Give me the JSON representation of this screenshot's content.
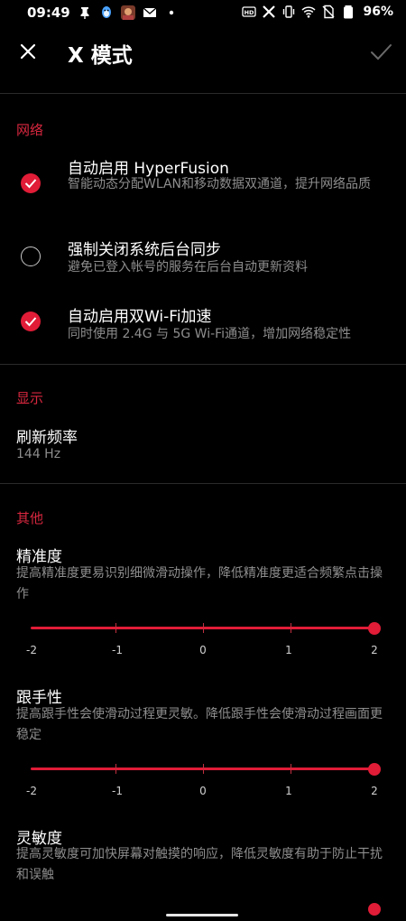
{
  "status_bar": {
    "time": "09:49",
    "battery": "96%",
    "left_icons": [
      "notification-pin-icon",
      "qq-penguin-icon",
      "game-avatar-icon",
      "mail-icon",
      "dot-icon"
    ],
    "right_icons": [
      "hd-icon",
      "x-app-icon",
      "vibrate-icon",
      "wifi-icon",
      "no-sim-icon",
      "battery-icon"
    ]
  },
  "header": {
    "title": "X 模式"
  },
  "network": {
    "section_title": "网络",
    "options": [
      {
        "title": "自动启用 HyperFusion",
        "desc": "智能动态分配WLAN和移动数据双通道，提升网络品质",
        "checked": true
      },
      {
        "title": "强制关闭系统后台同步",
        "desc": "避免已登入帐号的服务在后台自动更新资料",
        "checked": false
      },
      {
        "title": "自动启用双Wi-Fi加速",
        "desc": "同时使用 2.4G 与 5G Wi-Fi通道，增加网络稳定性",
        "checked": true
      }
    ]
  },
  "display": {
    "section_title": "显示",
    "refresh_rate_title": "刷新频率",
    "refresh_rate_value": "144 Hz"
  },
  "other": {
    "section_title": "其他",
    "precision": {
      "title": "精准度",
      "desc": "提高精准度更易识别细微滑动操作，降低精准度更适合频繁点击操作",
      "value": 2,
      "min": -2,
      "max": 2,
      "labels": [
        "-2",
        "-1",
        "0",
        "1",
        "2"
      ]
    },
    "tracking": {
      "title": "跟手性",
      "desc": "提高跟手性会使滑动过程更灵敏。降低跟手性会使滑动过程画面更稳定",
      "value": 2,
      "min": -2,
      "max": 2,
      "labels": [
        "-2",
        "-1",
        "0",
        "1",
        "2"
      ]
    },
    "sensitivity": {
      "title": "灵敏度",
      "desc": "提高灵敏度可加快屏幕对触摸的响应，降低灵敏度有助于防止干扰和误触"
    }
  },
  "colors": {
    "accent": "#e01c37",
    "section_title": "#d8273f",
    "secondary_text": "#8e8e8e",
    "background": "#000000"
  }
}
